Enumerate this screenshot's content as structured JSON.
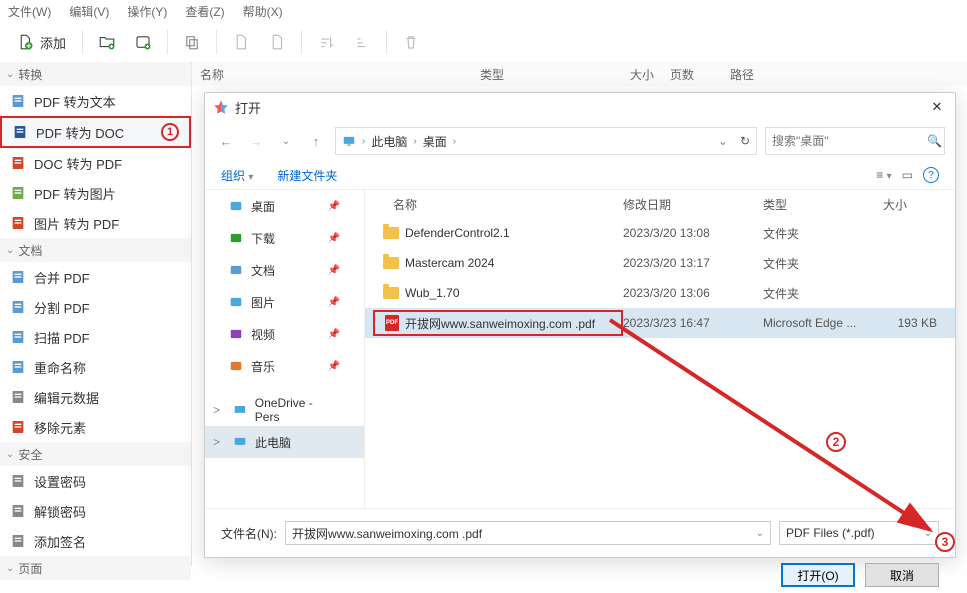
{
  "menubar": [
    "文件(W)",
    "编辑(V)",
    "操作(Y)",
    "查看(Z)",
    "帮助(X)"
  ],
  "toolbar": {
    "add": "添加"
  },
  "sidebar": {
    "groups": [
      {
        "title": "转换",
        "items": [
          {
            "label": "PDF 转为文本",
            "icon": "doc-text"
          },
          {
            "label": "PDF 转为 DOC",
            "icon": "doc-word",
            "selected": true,
            "marker": "①"
          },
          {
            "label": "DOC 转为 PDF",
            "icon": "doc-pdf"
          },
          {
            "label": "PDF 转为图片",
            "icon": "doc-img"
          },
          {
            "label": "图片 转为 PDF",
            "icon": "img-pdf"
          }
        ]
      },
      {
        "title": "文档",
        "items": [
          {
            "label": "合并 PDF",
            "icon": "merge"
          },
          {
            "label": "分割 PDF",
            "icon": "split"
          },
          {
            "label": "扫描 PDF",
            "icon": "scan"
          },
          {
            "label": "重命名称",
            "icon": "rename"
          },
          {
            "label": "编辑元数据",
            "icon": "meta"
          },
          {
            "label": "移除元素",
            "icon": "remove"
          }
        ]
      },
      {
        "title": "安全",
        "items": [
          {
            "label": "设置密码",
            "icon": "lock"
          },
          {
            "label": "解锁密码",
            "icon": "unlock"
          },
          {
            "label": "添加签名",
            "icon": "sign"
          }
        ]
      },
      {
        "title": "页面",
        "items": []
      }
    ]
  },
  "list_header": {
    "name": "名称",
    "type": "类型",
    "size": "大小",
    "pages": "页数",
    "path": "路径"
  },
  "dialog": {
    "title": "打开",
    "path": {
      "root": "此电脑",
      "folder": "桌面"
    },
    "search_placeholder": "搜索\"桌面\"",
    "refresh": "↻",
    "organize": "组织",
    "newfolder": "新建文件夹",
    "side_items": [
      {
        "label": "桌面",
        "pin": true,
        "icon": "desktop"
      },
      {
        "label": "下载",
        "pin": true,
        "icon": "download"
      },
      {
        "label": "文档",
        "pin": true,
        "icon": "docs"
      },
      {
        "label": "图片",
        "pin": true,
        "icon": "pics"
      },
      {
        "label": "视频",
        "pin": true,
        "icon": "video"
      },
      {
        "label": "音乐",
        "pin": true,
        "icon": "music"
      }
    ],
    "side_groups": [
      {
        "label": "OneDrive - Pers",
        "expand": ">"
      },
      {
        "label": "此电脑",
        "expand": ">",
        "selected": true
      }
    ],
    "file_header": {
      "name": "名称",
      "date": "修改日期",
      "type": "类型",
      "size": "大小"
    },
    "files": [
      {
        "name": "DefenderControl2.1",
        "date": "2023/3/20 13:08",
        "type": "文件夹",
        "size": "",
        "kind": "folder"
      },
      {
        "name": "Mastercam 2024",
        "date": "2023/3/20 13:17",
        "type": "文件夹",
        "size": "",
        "kind": "folder"
      },
      {
        "name": "Wub_1.70",
        "date": "2023/3/20 13:06",
        "type": "文件夹",
        "size": "",
        "kind": "folder"
      },
      {
        "name": "开拔网www.sanweimoxing.com .pdf",
        "date": "2023/3/23 16:47",
        "type": "Microsoft Edge ...",
        "size": "193 KB",
        "kind": "pdf",
        "selected": true,
        "boxed": true,
        "marker": "②"
      }
    ],
    "filename_label": "文件名(N):",
    "filename_value": "开拔网www.sanweimoxing.com .pdf",
    "filetype_value": "PDF Files (*.pdf)",
    "open_btn": "打开(O)",
    "cancel_btn": "取消",
    "open_marker": "③"
  }
}
